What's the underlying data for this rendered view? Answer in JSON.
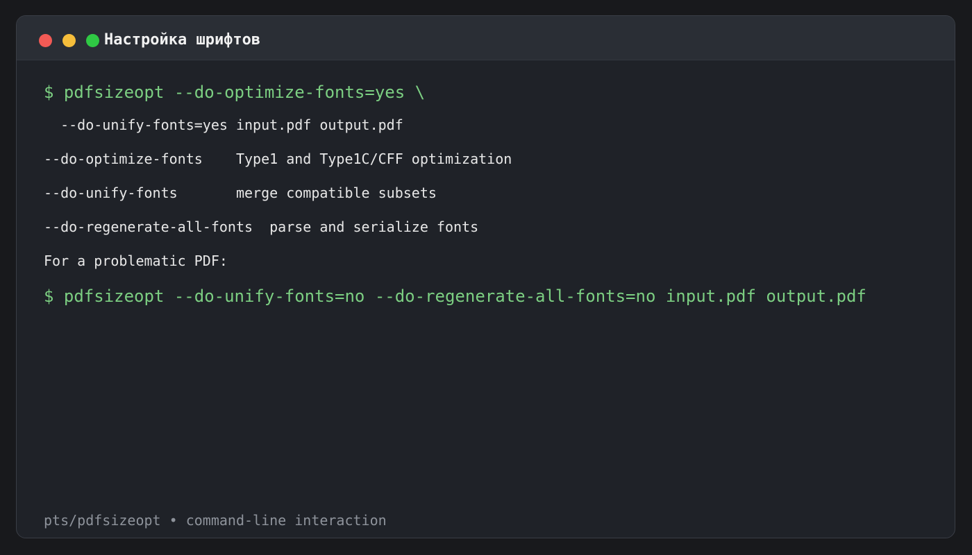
{
  "window": {
    "title": "Настройка шрифтов",
    "controls": {
      "close_color": "#f25a55",
      "minimize_color": "#f6be3b",
      "zoom_color": "#2fc944"
    }
  },
  "terminal": {
    "prompt_color": "#7ccf82",
    "lines": [
      {
        "kind": "command",
        "text": "$ pdfsizeopt --do-optimize-fonts=yes \\"
      },
      {
        "kind": "output",
        "text": "  --do-unify-fonts=yes input.pdf output.pdf"
      },
      {
        "kind": "output",
        "text": "--do-optimize-fonts    Type1 and Type1C/CFF optimization"
      },
      {
        "kind": "output",
        "text": "--do-unify-fonts       merge compatible subsets"
      },
      {
        "kind": "output",
        "text": "--do-regenerate-all-fonts  parse and serialize fonts"
      },
      {
        "kind": "output",
        "text": "For a problematic PDF:"
      },
      {
        "kind": "command",
        "text": "$ pdfsizeopt --do-unify-fonts=no --do-regenerate-all-fonts=no input.pdf output.pdf"
      }
    ]
  },
  "footer": {
    "text": "pts/pdfsizeopt • command-line interaction"
  }
}
